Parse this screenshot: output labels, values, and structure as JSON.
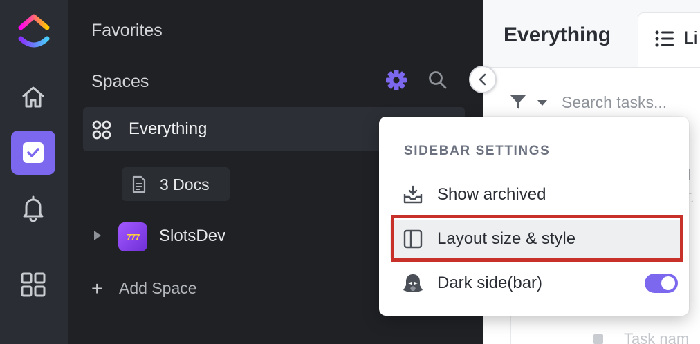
{
  "rail": {
    "items": [
      "home",
      "tasks",
      "notifications",
      "apps"
    ],
    "active": "tasks"
  },
  "sidebar": {
    "favorites_label": "Favorites",
    "spaces_label": "Spaces",
    "everything_label": "Everything",
    "docs_label": "3 Docs",
    "space_name": "SlotsDev",
    "space_icon_text": "777",
    "add_space_label": "Add Space"
  },
  "main": {
    "title": "Everything",
    "tab_label": "Li",
    "search_placeholder": "Search tasks...",
    "ghost_header": "d",
    "ghost_sub": "T.",
    "ghost_task": "Task nam"
  },
  "popup": {
    "heading": "SIDEBAR SETTINGS",
    "items": [
      {
        "label": "Show archived",
        "icon": "archive-tray-icon"
      },
      {
        "label": "Layout size & style",
        "icon": "layout-panel-icon",
        "highlighted": true
      },
      {
        "label": "Dark side(bar)",
        "icon": "darth-vader-icon",
        "toggle": true
      }
    ]
  },
  "colors": {
    "accent": "#7b68ee",
    "rail_bg": "#2a2e34",
    "sidebar_bg": "#1f2125",
    "highlight_border": "#c8302a"
  }
}
